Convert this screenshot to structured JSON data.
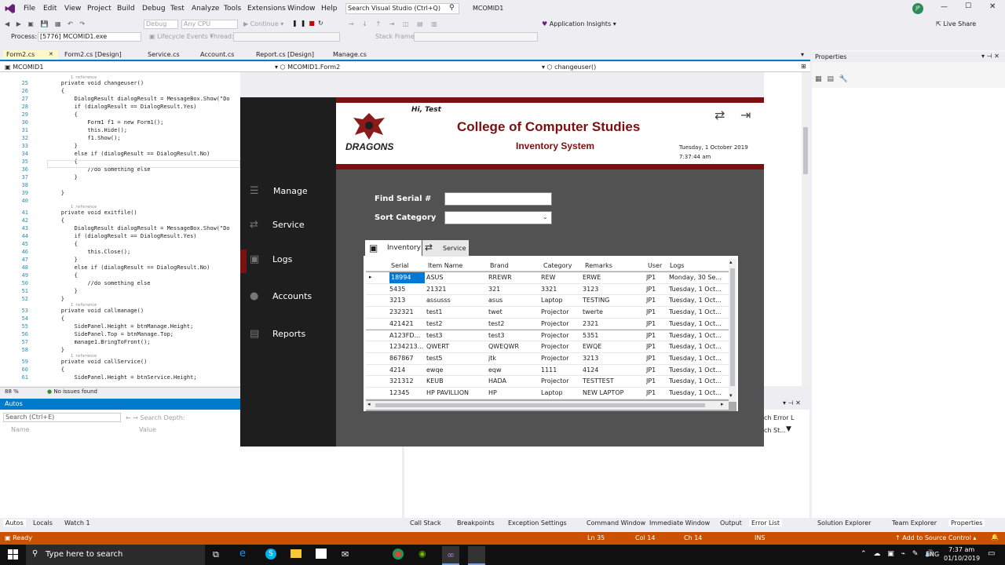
{
  "menu": [
    "File",
    "Edit",
    "View",
    "Project",
    "Build",
    "Debug",
    "Test",
    "Analyze",
    "Tools",
    "Extensions",
    "Window",
    "Help"
  ],
  "search_placeholder": "Search Visual Studio (Ctrl+Q)",
  "solution_name": "MCOMID1",
  "user_initials": "JP",
  "toolbar": {
    "config": "Debug",
    "platform": "Any CPU",
    "continue": "Continue",
    "app_insights": "Application Insights",
    "live_share": "Live Share"
  },
  "toolbar2": {
    "process_label": "Process:",
    "process_value": "[5776] MCOMID1.exe",
    "lifecycle": "Lifecycle Events",
    "thread": "Thread:",
    "stack_frame": "Stack Frame:"
  },
  "doc_tabs": [
    "Form2.cs",
    "Form2.cs [Design]",
    "Service.cs",
    "Account.cs",
    "Report.cs [Design]",
    "Manage.cs"
  ],
  "nav": {
    "project": "MCOMID1",
    "class": "MCOMID1.Form2",
    "method": "changeuser()"
  },
  "code_lines": [
    {
      "n": "25",
      "t": "        private void changeuser()"
    },
    {
      "n": "26",
      "t": "        {"
    },
    {
      "n": "27",
      "t": "            DialogResult dialogResult = MessageBox.Show(\"Do"
    },
    {
      "n": "28",
      "t": "            if (dialogResult == DialogResult.Yes)"
    },
    {
      "n": "29",
      "t": "            {"
    },
    {
      "n": "30",
      "t": "                Form1 f1 = new Form1();"
    },
    {
      "n": "31",
      "t": "                this.Hide();"
    },
    {
      "n": "32",
      "t": "                f1.Show();"
    },
    {
      "n": "33",
      "t": "            }"
    },
    {
      "n": "34",
      "t": "            else if (dialogResult == DialogResult.No)"
    },
    {
      "n": "35",
      "t": "            {"
    },
    {
      "n": "36",
      "t": "                //do something else"
    },
    {
      "n": "37",
      "t": "            }"
    },
    {
      "n": "38",
      "t": ""
    },
    {
      "n": "39",
      "t": "        }"
    },
    {
      "n": "40",
      "t": ""
    },
    {
      "n": "41",
      "t": "        private void exitfile()"
    },
    {
      "n": "42",
      "t": "        {"
    },
    {
      "n": "43",
      "t": "            DialogResult dialogResult = MessageBox.Show(\"Do"
    },
    {
      "n": "44",
      "t": "            if (dialogResult == DialogResult.Yes)"
    },
    {
      "n": "45",
      "t": "            {"
    },
    {
      "n": "46",
      "t": "                this.Close();"
    },
    {
      "n": "47",
      "t": "            }"
    },
    {
      "n": "48",
      "t": "            else if (dialogResult == DialogResult.No)"
    },
    {
      "n": "49",
      "t": "            {"
    },
    {
      "n": "50",
      "t": "                //do something else"
    },
    {
      "n": "51",
      "t": "            }"
    },
    {
      "n": "52",
      "t": "        }"
    },
    {
      "n": "53",
      "t": "        private void callmanage()"
    },
    {
      "n": "54",
      "t": "        {"
    },
    {
      "n": "55",
      "t": "            SidePanel.Height = btnManage.Height;"
    },
    {
      "n": "56",
      "t": "            SidePanel.Top = btnManage.Top;"
    },
    {
      "n": "57",
      "t": "            manage1.BringToFront();"
    },
    {
      "n": "58",
      "t": "        }"
    },
    {
      "n": "59",
      "t": "        private void callService()"
    },
    {
      "n": "60",
      "t": "        {"
    },
    {
      "n": "61",
      "t": "            SidePanel.Height = btnService.Height;"
    }
  ],
  "ref_label": "1 reference",
  "zoom": "88 %",
  "issues": "No issues found",
  "properties_title": "Properties",
  "autos": {
    "title": "Autos",
    "search": "Search (Ctrl+E)",
    "depth": "Search Depth:",
    "col_name": "Name",
    "col_value": "Value"
  },
  "error_partial": "ch Error L",
  "error_partial2": "ch St...",
  "bottom_tabs_left": [
    "Autos",
    "Locals",
    "Watch 1"
  ],
  "bottom_tabs_mid": [
    "Call Stack",
    "Breakpoints",
    "Exception Settings",
    "Command Window",
    "Immediate Window",
    "Output",
    "Error List"
  ],
  "bottom_tabs_right": [
    "Solution Explorer",
    "Team Explorer",
    "Properties"
  ],
  "status": {
    "ready": "Ready",
    "ln": "Ln 35",
    "col": "Col 14",
    "ch": "Ch 14",
    "ins": "INS",
    "source_control": "Add to Source Control"
  },
  "taskbar": {
    "search": "Type here to search",
    "time": "7:37 am",
    "date": "01/10/2019",
    "lang": "ENG"
  },
  "app": {
    "greeting": "Hi, Test",
    "title": "College of Computer Studies",
    "subtitle": "Inventory System",
    "date": "Tuesday, 1 October 2019",
    "time": "7:37:44 am",
    "logo_text": "DRAGONS",
    "nav": [
      "Manage",
      "Service",
      "Logs",
      "Accounts",
      "Reports"
    ],
    "find_label": "Find Serial #",
    "sort_label": "Sort Category",
    "tab_inventory": "Inventory",
    "tab_service": "Service",
    "columns": [
      "Serial",
      "Item Name",
      "Brand",
      "Category",
      "Remarks",
      "User",
      "Logs"
    ],
    "rows": [
      [
        "18994",
        "ASUS",
        "RREWR",
        "REW",
        "ERWE",
        "JP1",
        "Monday, 30 Se..."
      ],
      [
        "5435",
        "21321",
        "321",
        "3321",
        "3123",
        "JP1",
        "Tuesday, 1 Oct..."
      ],
      [
        "3213",
        "assusss",
        "asus",
        "Laptop",
        "TESTING",
        "JP1",
        "Tuesday, 1 Oct..."
      ],
      [
        "232321",
        "test1",
        "twet",
        "Projector",
        "twerte",
        "JP1",
        "Tuesday, 1 Oct..."
      ],
      [
        "421421",
        "test2",
        "test2",
        "Projector",
        "2321",
        "JP1",
        "Tuesday, 1 Oct..."
      ],
      [
        "A123FD...",
        "test3",
        "test3",
        "Projector",
        "5351",
        "JP1",
        "Tuesday, 1 Oct..."
      ],
      [
        "1234213...",
        "QWERT",
        "QWEQWR",
        "Projector",
        "EWQE",
        "JP1",
        "Tuesday, 1 Oct..."
      ],
      [
        "867867",
        "test5",
        "jtk",
        "Projector",
        "3213",
        "JP1",
        "Tuesday, 1 Oct..."
      ],
      [
        "4214",
        "ewqe",
        "eqw",
        "1111",
        "4124",
        "JP1",
        "Tuesday, 1 Oct..."
      ],
      [
        "321312",
        "KEUB",
        "HADA",
        "Projector",
        "TESTTEST",
        "JP1",
        "Tuesday, 1 Oct..."
      ],
      [
        "12345",
        "HP PAVILLION",
        "HP",
        "Laptop",
        "NEW LAPTOP",
        "JP1",
        "Tuesday, 1 Oct..."
      ]
    ]
  },
  "colors": {
    "accent": "#68217a",
    "status": "#ca5100",
    "app_red": "#7b1010",
    "app_dark": "#1e1e1e",
    "app_gray": "#525252"
  }
}
